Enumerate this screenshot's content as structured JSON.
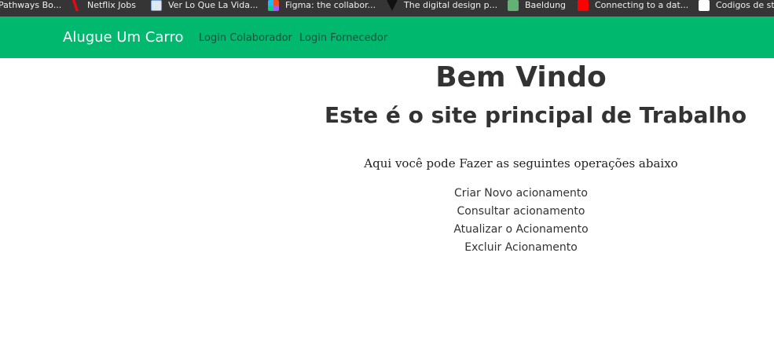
{
  "bookmarks": [
    {
      "label": "Pathways Bo...",
      "icon": "bookmark-icon"
    },
    {
      "label": "Netflix Jobs",
      "icon": "netflix-icon"
    },
    {
      "label": "Ver Lo Que La Vida...",
      "icon": "image-icon"
    },
    {
      "label": "Figma: the collabor...",
      "icon": "figma-icon"
    },
    {
      "label": "The digital design p...",
      "icon": "triangle-icon"
    },
    {
      "label": "Baeldung",
      "icon": "leaf-icon"
    },
    {
      "label": "Connecting to a dat...",
      "icon": "youtube-icon"
    },
    {
      "label": "Codigos de st",
      "icon": "page-icon"
    }
  ],
  "navbar": {
    "brand": "Alugue Um Carro",
    "links": [
      "Login Colaborador",
      "Login Fornecedor"
    ],
    "color": "#00b86e"
  },
  "main": {
    "title": "Bem Vindo",
    "subtitle": "Este é o site principal de Trabalho",
    "intro": "Aqui você pode Fazer as seguintes operações abaixo",
    "operations": [
      "Criar Novo acionamento",
      "Consultar acionamento",
      "Atualizar o Acionamento",
      "Excluir Acionamento"
    ]
  }
}
